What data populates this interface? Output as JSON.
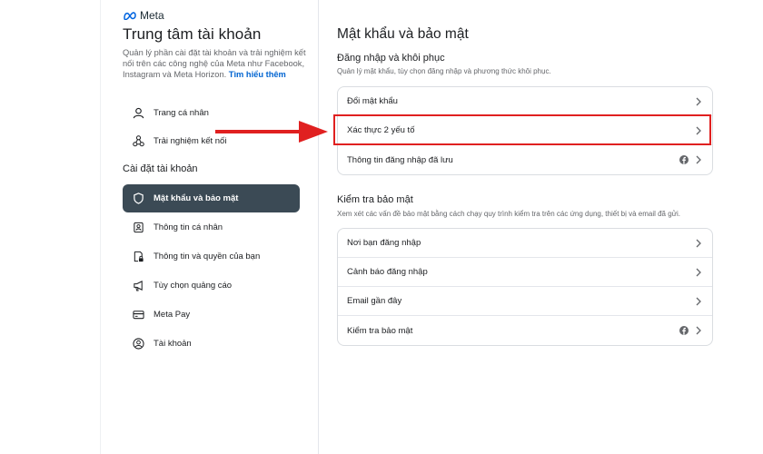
{
  "sidebar": {
    "logo_text": "Meta",
    "title": "Trung tâm tài khoản",
    "description": "Quản lý phần cài đặt tài khoản và trải nghiệm kết nối trên các công nghệ của Meta như Facebook, Instagram và Meta Horizon.",
    "learn_more": "Tìm hiểu thêm",
    "top_items": [
      {
        "label": "Trang cá nhân",
        "icon": "person-icon"
      },
      {
        "label": "Trải nghiệm kết nối",
        "icon": "connected-experiences-icon"
      }
    ],
    "settings_label": "Cài đặt tài khoản",
    "settings_items": [
      {
        "label": "Mật khẩu và bảo mật",
        "icon": "shield-icon",
        "active": true
      },
      {
        "label": "Thông tin cá nhân",
        "icon": "id-card-icon"
      },
      {
        "label": "Thông tin và quyền của bạn",
        "icon": "document-lock-icon"
      },
      {
        "label": "Tùy chọn quảng cáo",
        "icon": "megaphone-icon"
      },
      {
        "label": "Meta Pay",
        "icon": "credit-card-icon"
      },
      {
        "label": "Tài khoản",
        "icon": "account-circle-icon"
      }
    ]
  },
  "main": {
    "title": "Mật khẩu và bảo mật",
    "login_section": {
      "title": "Đăng nhập và khôi phục",
      "subtitle": "Quản lý mật khẩu, tùy chọn đăng nhập và phương thức khôi phục.",
      "rows": [
        {
          "label": "Đổi mật khẩu",
          "fb": false
        },
        {
          "label": "Xác thực 2 yếu tố",
          "fb": false,
          "highlighted": true
        },
        {
          "label": "Thông tin đăng nhập đã lưu",
          "fb": true
        }
      ]
    },
    "security_section": {
      "title": "Kiểm tra bảo mật",
      "subtitle": "Xem xét các vấn đề bảo mật bằng cách chạy quy trình kiểm tra trên các ứng dụng, thiết bị và email đã gửi.",
      "rows": [
        {
          "label": "Nơi bạn đăng nhập",
          "fb": false
        },
        {
          "label": "Cảnh báo đăng nhập",
          "fb": false
        },
        {
          "label": "Email gần đây",
          "fb": false
        },
        {
          "label": "Kiểm tra bảo mật",
          "fb": true
        }
      ]
    }
  },
  "colors": {
    "active_bg": "#3b4a55",
    "highlight": "#e02020",
    "link": "#0064d1"
  }
}
